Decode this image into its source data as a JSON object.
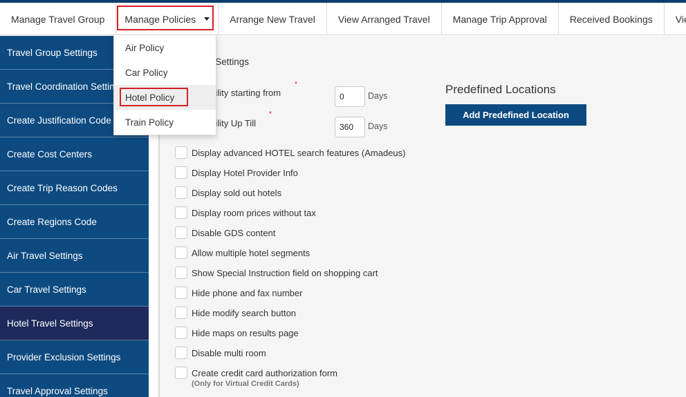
{
  "topnav": {
    "items": [
      {
        "label": "Manage Travel Group"
      },
      {
        "label": "Manage Policies"
      },
      {
        "label": "Arrange New Travel"
      },
      {
        "label": "View Arranged Travel"
      },
      {
        "label": "Manage Trip Approval"
      },
      {
        "label": "Received Bookings"
      },
      {
        "label": "View"
      }
    ]
  },
  "dropdown": {
    "items": [
      {
        "label": "Air Policy"
      },
      {
        "label": "Car Policy"
      },
      {
        "label": "Hotel Policy"
      },
      {
        "label": "Train Policy"
      }
    ]
  },
  "sidebar": {
    "items": [
      {
        "label": "Travel Group Settings"
      },
      {
        "label": "Travel Coordination Settings"
      },
      {
        "label": "Create Justification Code"
      },
      {
        "label": "Create Cost Centers"
      },
      {
        "label": "Create Trip Reason Codes"
      },
      {
        "label": "Create Regions Code"
      },
      {
        "label": "Air Travel Settings"
      },
      {
        "label": "Car Travel Settings"
      },
      {
        "label": "Hotel Travel Settings"
      },
      {
        "label": "Provider Exclusion Settings"
      },
      {
        "label": "Travel Approval Settings"
      }
    ]
  },
  "main": {
    "section_title": "el Settings",
    "availability_from": {
      "label": "ability starting from",
      "value": "0",
      "unit": "Days"
    },
    "availability_till": {
      "label": "ability Up Till",
      "value": "360",
      "unit": "Days"
    },
    "required_mark": "*",
    "predefined": {
      "title": "Predefined Locations",
      "button_label": "Add Predefined Location"
    },
    "options": [
      {
        "label": "Display advanced HOTEL search features (Amadeus)"
      },
      {
        "label": "Display Hotel Provider Info"
      },
      {
        "label": "Display sold out hotels"
      },
      {
        "label": "Display room prices without tax"
      },
      {
        "label": "Disable GDS content"
      },
      {
        "label": "Allow multiple hotel segments"
      },
      {
        "label": "Show Special Instruction field on shopping cart"
      },
      {
        "label": "Hide phone and fax number"
      },
      {
        "label": "Hide modify search button"
      },
      {
        "label": "Hide maps on results page"
      },
      {
        "label": "Disable multi room"
      },
      {
        "label": "Create credit card authorization form"
      }
    ],
    "credit_card_note": "(Only for Virtual Credit Cards)"
  }
}
